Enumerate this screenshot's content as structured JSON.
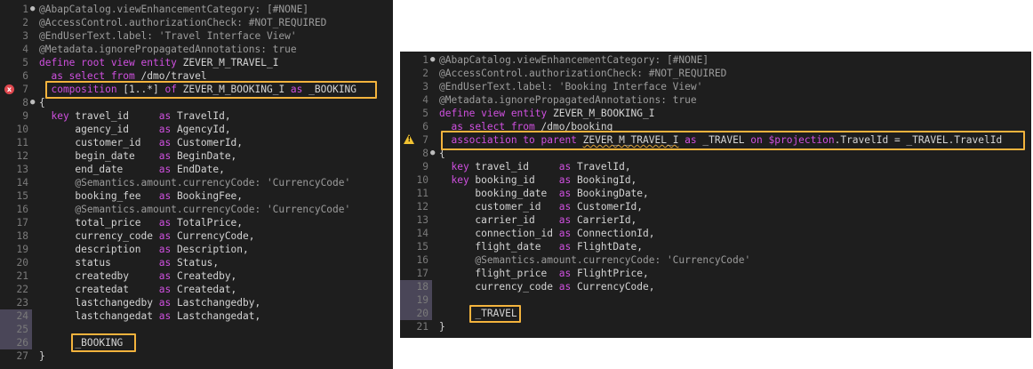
{
  "left": {
    "lines": [
      {
        "n": "1",
        "fold": true,
        "segments": [
          [
            "ann",
            "@AbapCatalog.viewEnhancementCategory: [#NONE]"
          ]
        ]
      },
      {
        "n": "2",
        "segments": [
          [
            "ann",
            "@AccessControl.authorizationCheck: #NOT_REQUIRED"
          ]
        ]
      },
      {
        "n": "3",
        "segments": [
          [
            "ann",
            "@EndUserText.label: 'Travel Interface View'"
          ]
        ]
      },
      {
        "n": "4",
        "segments": [
          [
            "ann",
            "@Metadata.ignorePropagatedAnnotations: true"
          ]
        ]
      },
      {
        "n": "5",
        "segments": [
          [
            "kw",
            "define root view entity "
          ],
          [
            "type",
            "ZEVER_M_TRAVEL_I"
          ]
        ]
      },
      {
        "n": "6",
        "segments": [
          [
            "kw",
            "  as select from "
          ],
          [
            "type",
            "/dmo/travel"
          ]
        ]
      },
      {
        "n": "7",
        "segments": [
          [
            "kw",
            "  composition "
          ],
          [
            "type",
            "[1..*] "
          ],
          [
            "kw",
            "of "
          ],
          [
            "type",
            "ZEVER_M_BOOKING_I "
          ],
          [
            "kw",
            "as "
          ],
          [
            "type",
            "_BOOKING"
          ]
        ]
      },
      {
        "n": "8",
        "fold": true,
        "segments": [
          [
            "type",
            "{"
          ]
        ]
      },
      {
        "n": "9",
        "segments": [
          [
            "kw",
            "  key "
          ],
          [
            "type",
            "travel_id     "
          ],
          [
            "kw",
            "as "
          ],
          [
            "type",
            "TravelId,"
          ]
        ]
      },
      {
        "n": "10",
        "segments": [
          [
            "type",
            "      agency_id     "
          ],
          [
            "kw",
            "as "
          ],
          [
            "type",
            "AgencyId,"
          ]
        ]
      },
      {
        "n": "11",
        "segments": [
          [
            "type",
            "      customer_id   "
          ],
          [
            "kw",
            "as "
          ],
          [
            "type",
            "CustomerId,"
          ]
        ]
      },
      {
        "n": "12",
        "segments": [
          [
            "type",
            "      begin_date    "
          ],
          [
            "kw",
            "as "
          ],
          [
            "type",
            "BeginDate,"
          ]
        ]
      },
      {
        "n": "13",
        "segments": [
          [
            "type",
            "      end_date      "
          ],
          [
            "kw",
            "as "
          ],
          [
            "type",
            "EndDate,"
          ]
        ]
      },
      {
        "n": "14",
        "segments": [
          [
            "ann",
            "      @Semantics.amount.currencyCode: 'CurrencyCode'"
          ]
        ]
      },
      {
        "n": "15",
        "segments": [
          [
            "type",
            "      booking_fee   "
          ],
          [
            "kw",
            "as "
          ],
          [
            "type",
            "BookingFee,"
          ]
        ]
      },
      {
        "n": "16",
        "segments": [
          [
            "ann",
            "      @Semantics.amount.currencyCode: 'CurrencyCode'"
          ]
        ]
      },
      {
        "n": "17",
        "segments": [
          [
            "type",
            "      total_price   "
          ],
          [
            "kw",
            "as "
          ],
          [
            "type",
            "TotalPrice,"
          ]
        ]
      },
      {
        "n": "18",
        "segments": [
          [
            "type",
            "      currency_code "
          ],
          [
            "kw",
            "as "
          ],
          [
            "type",
            "CurrencyCode,"
          ]
        ]
      },
      {
        "n": "19",
        "segments": [
          [
            "type",
            "      description   "
          ],
          [
            "kw",
            "as "
          ],
          [
            "type",
            "Description,"
          ]
        ]
      },
      {
        "n": "20",
        "segments": [
          [
            "type",
            "      status        "
          ],
          [
            "kw",
            "as "
          ],
          [
            "type",
            "Status,"
          ]
        ]
      },
      {
        "n": "21",
        "segments": [
          [
            "type",
            "      createdby     "
          ],
          [
            "kw",
            "as "
          ],
          [
            "type",
            "Createdby,"
          ]
        ]
      },
      {
        "n": "22",
        "segments": [
          [
            "type",
            "      createdat     "
          ],
          [
            "kw",
            "as "
          ],
          [
            "type",
            "Createdat,"
          ]
        ]
      },
      {
        "n": "23",
        "segments": [
          [
            "type",
            "      lastchangedby "
          ],
          [
            "kw",
            "as "
          ],
          [
            "type",
            "Lastchangedby,"
          ]
        ]
      },
      {
        "n": "24",
        "shade": true,
        "segments": [
          [
            "type",
            "      lastchangedat "
          ],
          [
            "kw",
            "as "
          ],
          [
            "type",
            "Lastchangedat,"
          ]
        ]
      },
      {
        "n": "25",
        "shade": true,
        "segments": [
          [
            "type",
            ""
          ]
        ]
      },
      {
        "n": "26",
        "shade": true,
        "segments": [
          [
            "type",
            "      _BOOKING"
          ]
        ]
      },
      {
        "n": "27",
        "segments": [
          [
            "type",
            "}"
          ]
        ]
      }
    ]
  },
  "right": {
    "lines": [
      {
        "n": "1",
        "fold": true,
        "segments": [
          [
            "ann",
            "@AbapCatalog.viewEnhancementCategory: [#NONE]"
          ]
        ]
      },
      {
        "n": "2",
        "segments": [
          [
            "ann",
            "@AccessControl.authorizationCheck: #NOT_REQUIRED"
          ]
        ]
      },
      {
        "n": "3",
        "segments": [
          [
            "ann",
            "@EndUserText.label: 'Booking Interface View'"
          ]
        ]
      },
      {
        "n": "4",
        "segments": [
          [
            "ann",
            "@Metadata.ignorePropagatedAnnotations: true"
          ]
        ]
      },
      {
        "n": "5",
        "segments": [
          [
            "kw",
            "define view entity "
          ],
          [
            "type",
            "ZEVER_M_BOOKING_I"
          ]
        ]
      },
      {
        "n": "6",
        "segments": [
          [
            "kw",
            "  as select from "
          ],
          [
            "type",
            "/dmo/booking"
          ]
        ]
      },
      {
        "n": "7",
        "segments": [
          [
            "kw",
            "  association to parent "
          ],
          [
            "warn",
            "ZEVER_M_TRAVEL_I"
          ],
          [
            "kw",
            " as "
          ],
          [
            "type",
            "_TRAVEL "
          ],
          [
            "kw",
            "on "
          ],
          [
            "kw",
            "$projection"
          ],
          [
            "type",
            ".TravelId = _TRAVEL.TravelId"
          ]
        ]
      },
      {
        "n": "8",
        "fold": true,
        "segments": [
          [
            "type",
            "{"
          ]
        ]
      },
      {
        "n": "9",
        "segments": [
          [
            "kw",
            "  key "
          ],
          [
            "type",
            "travel_id     "
          ],
          [
            "kw",
            "as "
          ],
          [
            "type",
            "TravelId,"
          ]
        ]
      },
      {
        "n": "10",
        "segments": [
          [
            "kw",
            "  key "
          ],
          [
            "type",
            "booking_id    "
          ],
          [
            "kw",
            "as "
          ],
          [
            "type",
            "BookingId,"
          ]
        ]
      },
      {
        "n": "11",
        "segments": [
          [
            "type",
            "      booking_date  "
          ],
          [
            "kw",
            "as "
          ],
          [
            "type",
            "BookingDate,"
          ]
        ]
      },
      {
        "n": "12",
        "segments": [
          [
            "type",
            "      customer_id   "
          ],
          [
            "kw",
            "as "
          ],
          [
            "type",
            "CustomerId,"
          ]
        ]
      },
      {
        "n": "13",
        "segments": [
          [
            "type",
            "      carrier_id    "
          ],
          [
            "kw",
            "as "
          ],
          [
            "type",
            "CarrierId,"
          ]
        ]
      },
      {
        "n": "14",
        "segments": [
          [
            "type",
            "      connection_id "
          ],
          [
            "kw",
            "as "
          ],
          [
            "type",
            "ConnectionId,"
          ]
        ]
      },
      {
        "n": "15",
        "segments": [
          [
            "type",
            "      flight_date   "
          ],
          [
            "kw",
            "as "
          ],
          [
            "type",
            "FlightDate,"
          ]
        ]
      },
      {
        "n": "16",
        "segments": [
          [
            "ann",
            "      @Semantics.amount.currencyCode: 'CurrencyCode'"
          ]
        ]
      },
      {
        "n": "17",
        "segments": [
          [
            "type",
            "      flight_price  "
          ],
          [
            "kw",
            "as "
          ],
          [
            "type",
            "FlightPrice,"
          ]
        ]
      },
      {
        "n": "18",
        "shade": true,
        "segments": [
          [
            "type",
            "      currency_code "
          ],
          [
            "kw",
            "as "
          ],
          [
            "type",
            "CurrencyCode,"
          ]
        ]
      },
      {
        "n": "19",
        "shade": true,
        "segments": [
          [
            "type",
            ""
          ]
        ]
      },
      {
        "n": "20",
        "shade": true,
        "segments": [
          [
            "type",
            "      _TRAVEL"
          ]
        ]
      },
      {
        "n": "21",
        "segments": [
          [
            "type",
            "}"
          ]
        ]
      }
    ]
  },
  "markers": {
    "left_error_glyph": "x",
    "right_warning_glyph": "!"
  }
}
